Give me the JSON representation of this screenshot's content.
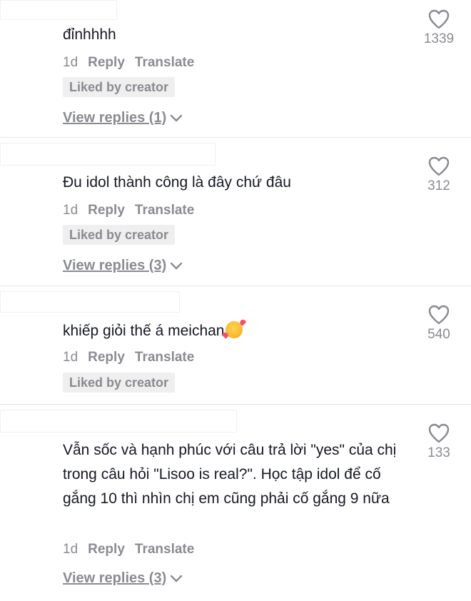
{
  "comments": [
    {
      "text": "đỉnhhhh",
      "age": "1d",
      "reply": "Reply",
      "translate": "Translate",
      "liked_badge": "Liked by creator",
      "view_replies": "View replies (1)",
      "likes": "1339"
    },
    {
      "text": "Đu idol thành công là đây chứ đâu",
      "age": "1d",
      "reply": "Reply",
      "translate": "Translate",
      "liked_badge": "Liked by creator",
      "view_replies": "View replies (3)",
      "likes": "312"
    },
    {
      "text": "khiếp giỏi thế á meichan",
      "emoji": "smiling-face-with-hearts-icon",
      "age": "1d",
      "reply": "Reply",
      "translate": "Translate",
      "liked_badge": "Liked by creator",
      "likes": "540"
    },
    {
      "text": "Vẫn sốc và hạnh phúc với câu trả lời \"yes\" của chị trong câu hỏi \"Lisoo is real?\". Học tập idol để cố gắng 10 thì nhìn chị em cũng phải cố gắng 9 nữa",
      "age": "1d",
      "reply": "Reply",
      "translate": "Translate",
      "view_replies": "View replies (3)",
      "likes": "133"
    }
  ],
  "colors": {
    "text": "#161823",
    "muted": "#8a8b91",
    "badge_bg": "#efefef"
  }
}
